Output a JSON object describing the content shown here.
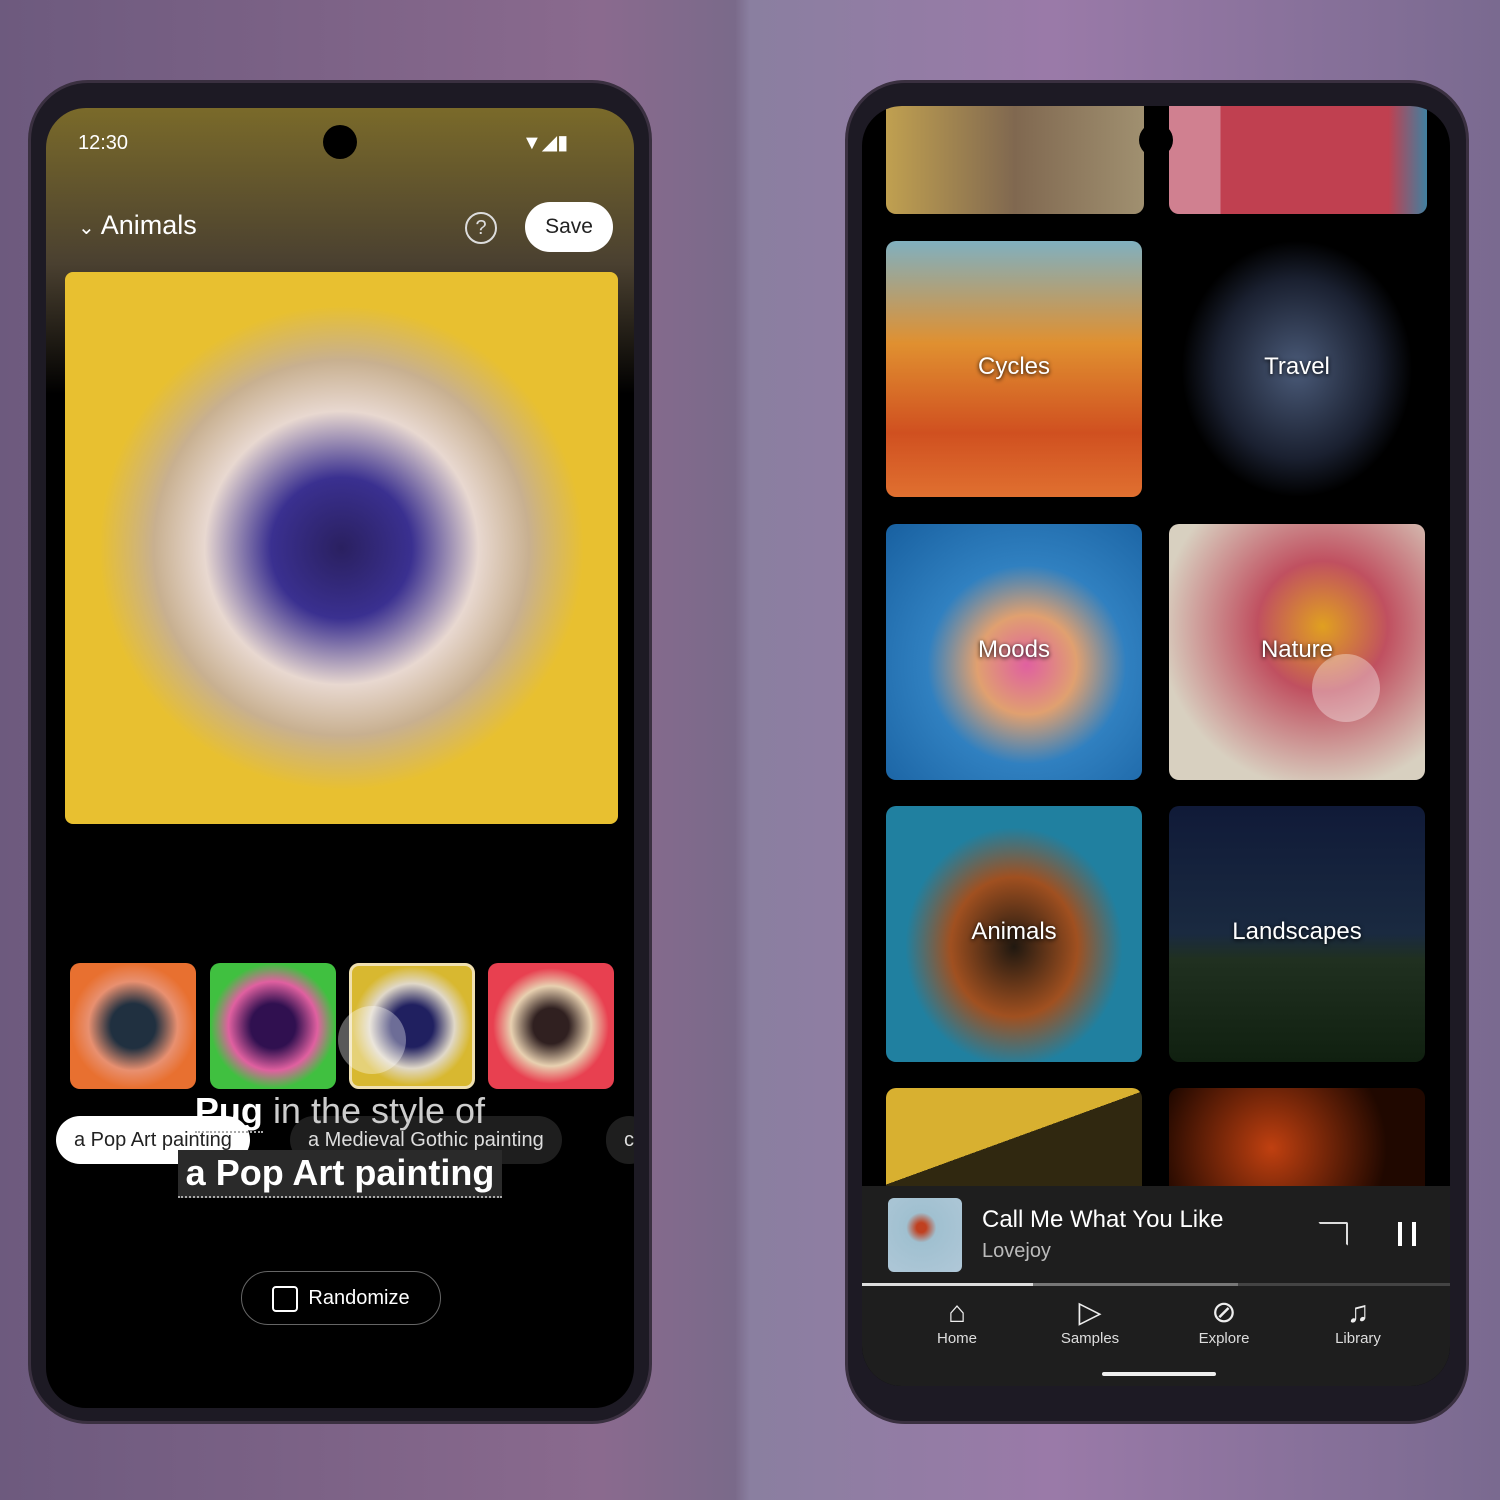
{
  "left": {
    "status": {
      "time": "12:30",
      "icons": [
        "wifi-icon",
        "signal-icon",
        "battery-icon"
      ]
    },
    "header": {
      "title": "Animals",
      "help_icon": "help-circle-icon",
      "save_label": "Save"
    },
    "styles": [
      "a Pop Art painting",
      "a Medieval Gothic painting",
      "c"
    ],
    "prompt": {
      "subject": "Pug",
      "connector": "in the style of",
      "style": "a Pop Art painting"
    },
    "randomize_label": "Randomize"
  },
  "right": {
    "tiles": [
      "Cycles",
      "Travel",
      "Moods",
      "Nature",
      "Animals",
      "Landscapes"
    ],
    "player": {
      "title": "Call Me What You Like",
      "artist": "Lovejoy",
      "progress": 0.29,
      "buffered": 0.64
    },
    "nav": [
      {
        "label": "Home",
        "icon": "home-icon"
      },
      {
        "label": "Samples",
        "icon": "samples-icon"
      },
      {
        "label": "Explore",
        "icon": "compass-icon"
      },
      {
        "label": "Library",
        "icon": "library-icon"
      }
    ]
  }
}
